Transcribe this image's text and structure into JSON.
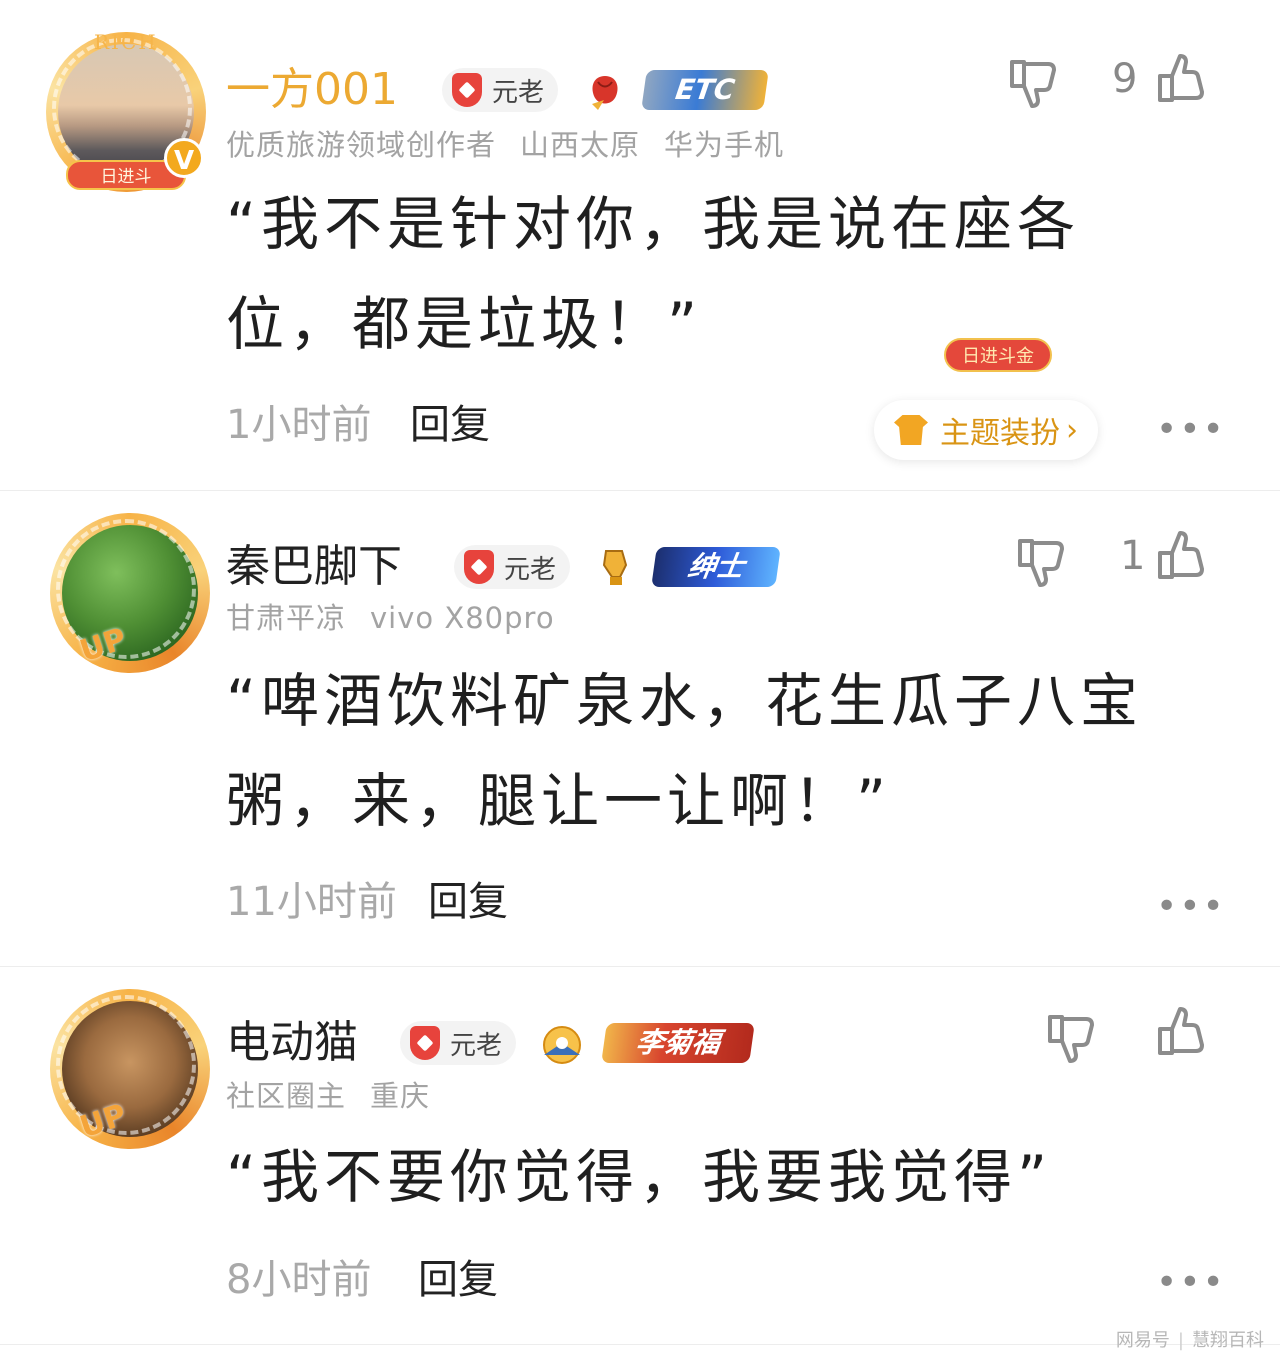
{
  "comments": [
    {
      "username": "一方001",
      "badge": "元老",
      "medal_icons": [
        "rose-medal-icon"
      ],
      "tag_badge": "ETC",
      "meta": [
        "优质旅游领域创作者",
        "山西太原",
        "华为手机"
      ],
      "body": "“我不是针对你，我是说在座各位，都是垃圾！”",
      "time": "1小时前",
      "reply_label": "回复",
      "like_count": "9",
      "avatar_frame_top": "RICH",
      "avatar_frame_banner": "日进斗",
      "avatar_badge": "V",
      "deco_tag": "日进斗金",
      "theme_button": "主题装扮",
      "theme_chevron": "›",
      "more": "•••"
    },
    {
      "username": "秦巴脚下",
      "badge": "元老",
      "medal_icons": [
        "trophy-hand-icon"
      ],
      "tag_badge": "绅士",
      "meta": [
        "甘肃平凉",
        "vivo X80pro"
      ],
      "body": "“啤酒饮料矿泉水，花生瓜子八宝粥，来，腿让一让啊！”",
      "time": "11小时前",
      "reply_label": "回复",
      "like_count": "1",
      "avatar_frame_banner": "UP",
      "more": "•••"
    },
    {
      "username": "电动猫",
      "badge": "元老",
      "medal_icons": [
        "sunrise-medal-icon"
      ],
      "tag_badge": "李菊福",
      "meta": [
        "社区圈主",
        "重庆"
      ],
      "body": "“我不要你觉得，我要我觉得”",
      "time": "8小时前",
      "reply_label": "回复",
      "like_count": "",
      "avatar_frame_banner": "UP",
      "more": "•••"
    }
  ],
  "watermark": [
    "网易号",
    "慧翔百科"
  ],
  "colors": {
    "vip_name": "#eca932",
    "badge_red": "#e7433c",
    "meta_gray": "#a3a3a3",
    "theme_gold": "#d99414",
    "etc_blue": "#3a7bd5",
    "gentleman_blue": "#2e5bd8",
    "lijufu_red": "#d8452e"
  }
}
